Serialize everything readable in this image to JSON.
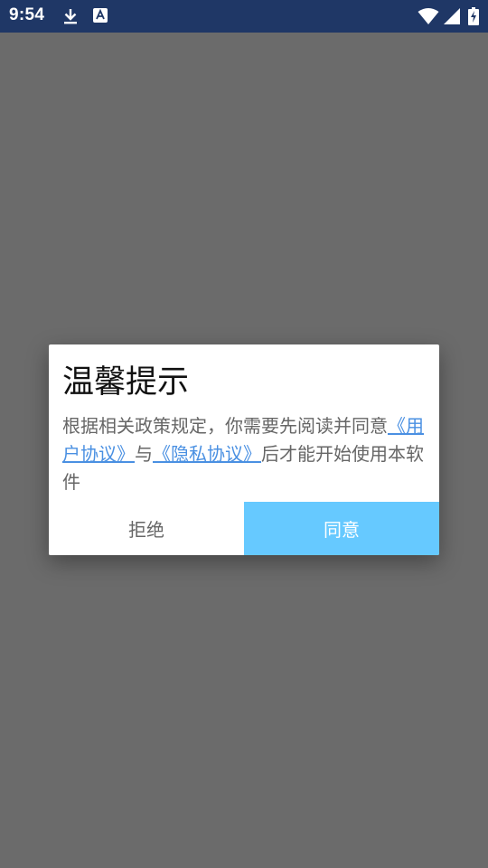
{
  "status_bar": {
    "time": "9:54",
    "left_icons": [
      "download-icon",
      "app-notification-icon"
    ],
    "right_icons": [
      "wifi-icon",
      "cellular-signal-icon",
      "battery-charging-icon"
    ],
    "background": "#1f3766"
  },
  "dialog": {
    "title": "温馨提示",
    "body": {
      "text_before": "根据相关政策规定，你需要先阅读并同意",
      "user_agreement_link": "《用户协议》",
      "connector": "与",
      "privacy_link": "《隐私协议》",
      "text_after": "后才能开始使用本软件"
    },
    "reject_label": "拒绝",
    "agree_label": "同意",
    "agree_color": "#66c9ff",
    "link_color": "#4a90e2"
  }
}
